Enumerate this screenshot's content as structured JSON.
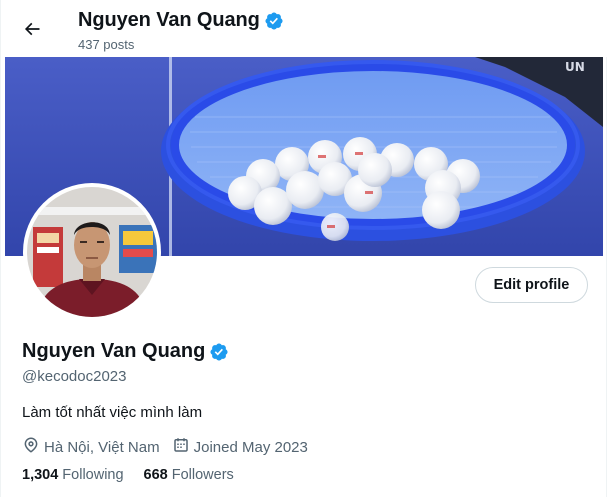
{
  "header": {
    "display_name": "Nguyen Van Quang",
    "posts_count": "437 posts",
    "back_icon": "arrow-left-icon"
  },
  "profile": {
    "display_name": "Nguyen Van Quang",
    "handle": "@kecodoc2023",
    "bio": "Làm tốt nhất việc mình làm",
    "location": "Hà Nội, Việt Nam",
    "joined": "Joined May 2023",
    "following_count": "1,304",
    "following_label": "Following",
    "followers_count": "668",
    "followers_label": "Followers",
    "edit_button_label": "Edit profile"
  },
  "colors": {
    "verified_blue": "#1d9bf0",
    "secondary_text": "#536471",
    "primary_text": "#0f1419",
    "banner_basket_blue": "#2c50e0"
  }
}
